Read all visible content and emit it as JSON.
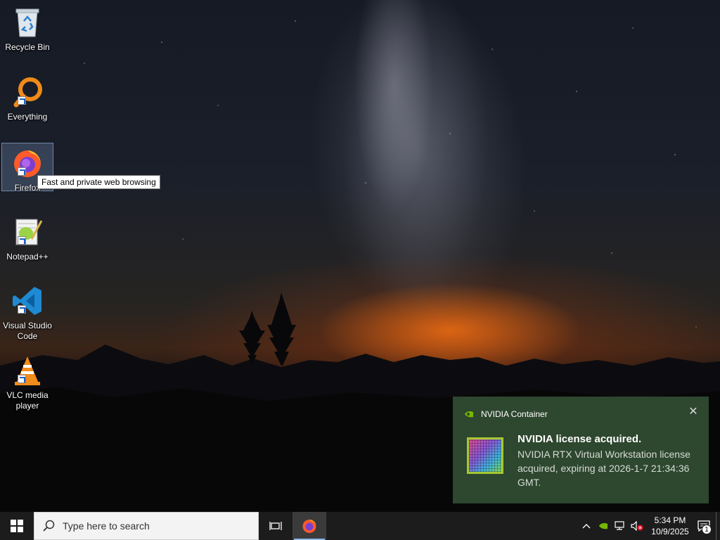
{
  "desktop": {
    "icons": [
      {
        "label": "Recycle Bin",
        "icon": "recycle-bin-icon"
      },
      {
        "label": "Everything",
        "icon": "everything-search-icon"
      },
      {
        "label": "Firefox",
        "icon": "firefox-icon"
      },
      {
        "label": "Notepad++",
        "icon": "notepad-plus-plus-icon"
      },
      {
        "label": "Visual Studio Code",
        "icon": "vscode-icon"
      },
      {
        "label": "VLC media player",
        "icon": "vlc-icon"
      }
    ],
    "tooltip": "Fast and private web browsing"
  },
  "notification": {
    "app_name": "NVIDIA Container",
    "title": "NVIDIA license acquired.",
    "body": "NVIDIA RTX Virtual Workstation license acquired, expiring at 2026-1-7 21:34:36 GMT.",
    "accent": "#2e472f"
  },
  "taskbar": {
    "search_placeholder": "Type here to search",
    "pinned": [
      "task-view-icon",
      "firefox-icon"
    ],
    "clock_time": "5:34 PM",
    "clock_date": "10/9/2025",
    "notification_count": "1"
  }
}
